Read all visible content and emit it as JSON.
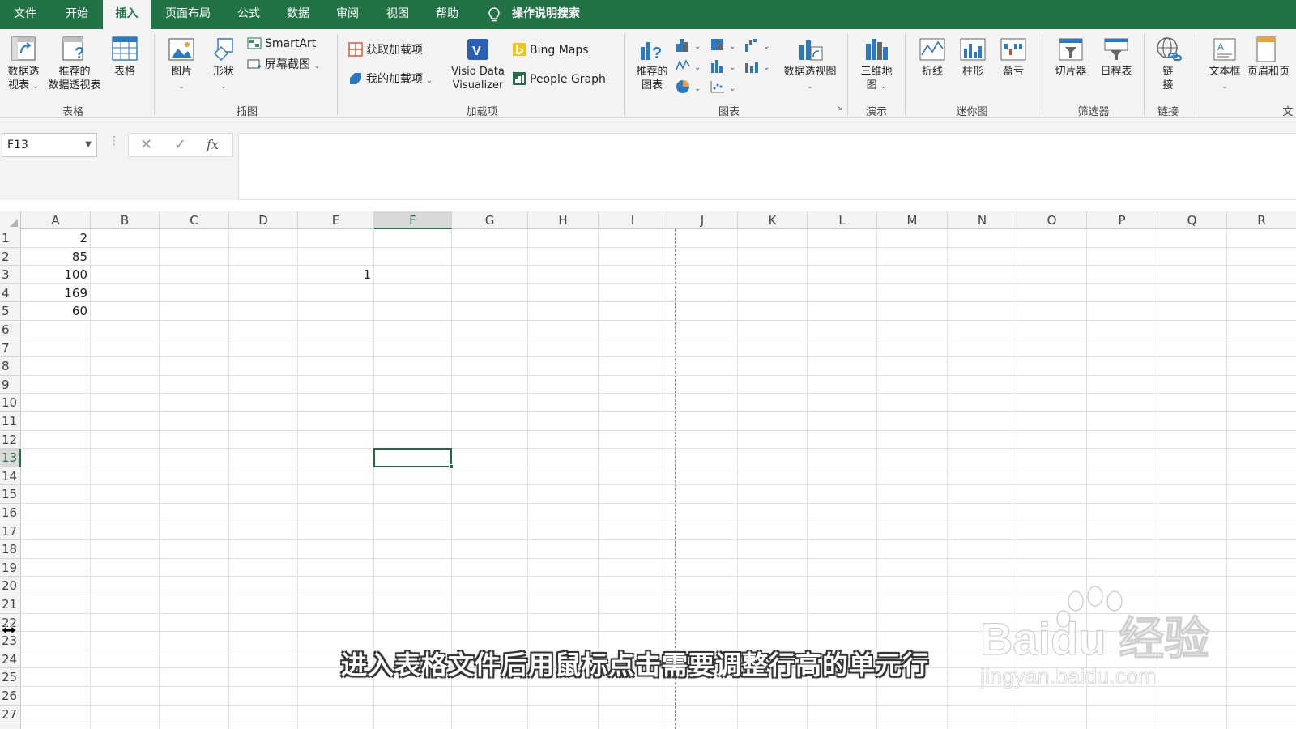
{
  "tabs": [
    {
      "label": "文件",
      "active": false
    },
    {
      "label": "开始",
      "active": false
    },
    {
      "label": "插入",
      "active": true
    },
    {
      "label": "页面布局",
      "active": false
    },
    {
      "label": "公式",
      "active": false
    },
    {
      "label": "数据",
      "active": false
    },
    {
      "label": "审阅",
      "active": false
    },
    {
      "label": "视图",
      "active": false
    },
    {
      "label": "帮助",
      "active": false
    }
  ],
  "tell_me": "操作说明搜索",
  "ribbon": {
    "groups": {
      "tables": "表格",
      "illustrations": "插图",
      "addins": "加载项",
      "charts": "图表",
      "tours": "演示",
      "sparklines": "迷你图",
      "filters": "筛选器",
      "links": "链接",
      "text": "文"
    },
    "buttons": {
      "pivot_table_l1": "数据透",
      "pivot_table_l2": "视表",
      "rec_pivot_l1": "推荐的",
      "rec_pivot_l2": "数据透视表",
      "table": "表格",
      "pictures": "图片",
      "shapes": "形状",
      "smartart": "SmartArt",
      "screenshot": "屏幕截图",
      "get_addins": "获取加载项",
      "my_addins": "我的加载项",
      "visio_l1": "Visio Data",
      "visio_l2": "Visualizer",
      "bing_maps": "Bing Maps",
      "people_graph": "People Graph",
      "rec_charts_l1": "推荐的",
      "rec_charts_l2": "图表",
      "pivot_chart": "数据透视图",
      "map3d_l1": "三维地",
      "map3d_l2": "图",
      "line": "折线",
      "column": "柱形",
      "winloss": "盈亏",
      "slicer": "切片器",
      "timeline": "日程表",
      "link_l1": "链",
      "link_l2": "接",
      "textbox": "文本框",
      "header_footer": "页眉和页"
    }
  },
  "formula_bar": {
    "name_box": "F13",
    "cancel": "✕",
    "enter": "✓",
    "fx": "fx",
    "value": ""
  },
  "columns": [
    "A",
    "B",
    "C",
    "D",
    "E",
    "F",
    "G",
    "H",
    "I",
    "J",
    "K",
    "L",
    "M",
    "N",
    "O",
    "P",
    "Q",
    "R"
  ],
  "rows": [
    "1",
    "2",
    "3",
    "4",
    "5",
    "6",
    "7",
    "8",
    "9",
    "10",
    "11",
    "12",
    "13",
    "14",
    "15",
    "16",
    "17",
    "18",
    "19",
    "20",
    "21",
    "22",
    "23",
    "24",
    "25",
    "26",
    "27"
  ],
  "active_cell": {
    "col": "F",
    "row": "13"
  },
  "cells": [
    {
      "ref": "A1",
      "value": "2"
    },
    {
      "ref": "A2",
      "value": "85"
    },
    {
      "ref": "A3",
      "value": "100"
    },
    {
      "ref": "A4",
      "value": "169"
    },
    {
      "ref": "A5",
      "value": "60"
    },
    {
      "ref": "E3",
      "value": "1"
    }
  ],
  "subtitle": "进入表格文件后用鼠标点击需要调整行高的单元行",
  "watermark": {
    "brand": "Baidu 经验",
    "url": "jingyan.baidu.com"
  },
  "colors": {
    "accent": "#217346",
    "ribbon_bg": "#f3f3f3",
    "grid_line": "#e1e1e1"
  }
}
